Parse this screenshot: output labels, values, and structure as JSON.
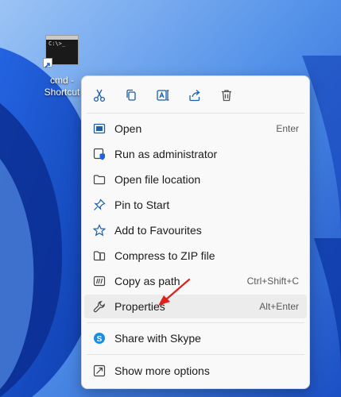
{
  "desktop": {
    "shortcut_label": "cmd - Shortcut",
    "cmd_prompt": "C:\\>_"
  },
  "context_menu": {
    "toolbar": [
      {
        "icon": "scissors-icon",
        "action": "cut"
      },
      {
        "icon": "copy-icon",
        "action": "copy"
      },
      {
        "icon": "rename-icon",
        "action": "rename"
      },
      {
        "icon": "share-icon",
        "action": "share"
      },
      {
        "icon": "trash-icon",
        "action": "delete"
      }
    ],
    "items": [
      {
        "label": "Open",
        "shortcut": "Enter",
        "icon": "open-icon"
      },
      {
        "label": "Run as administrator",
        "shortcut": "",
        "icon": "shield-icon"
      },
      {
        "label": "Open file location",
        "shortcut": "",
        "icon": "folder-icon"
      },
      {
        "label": "Pin to Start",
        "shortcut": "",
        "icon": "pin-icon"
      },
      {
        "label": "Add to Favourites",
        "shortcut": "",
        "icon": "star-icon"
      },
      {
        "label": "Compress to ZIP file",
        "shortcut": "",
        "icon": "zip-folder-icon"
      },
      {
        "label": "Copy as path",
        "shortcut": "Ctrl+Shift+C",
        "icon": "path-icon"
      },
      {
        "label": "Properties",
        "shortcut": "Alt+Enter",
        "icon": "wrench-icon"
      },
      {
        "label": "Share with Skype",
        "shortcut": "",
        "icon": "skype-icon"
      },
      {
        "label": "Show more options",
        "shortcut": "",
        "icon": "more-options-icon"
      }
    ]
  },
  "colors": {
    "wallpaper_light": "#5a9cf0",
    "wallpaper_dark": "#0b3aa8",
    "annotation_arrow": "#e0201b",
    "menu_bg": "#f9f9f9",
    "hover_bg": "#ececec"
  }
}
